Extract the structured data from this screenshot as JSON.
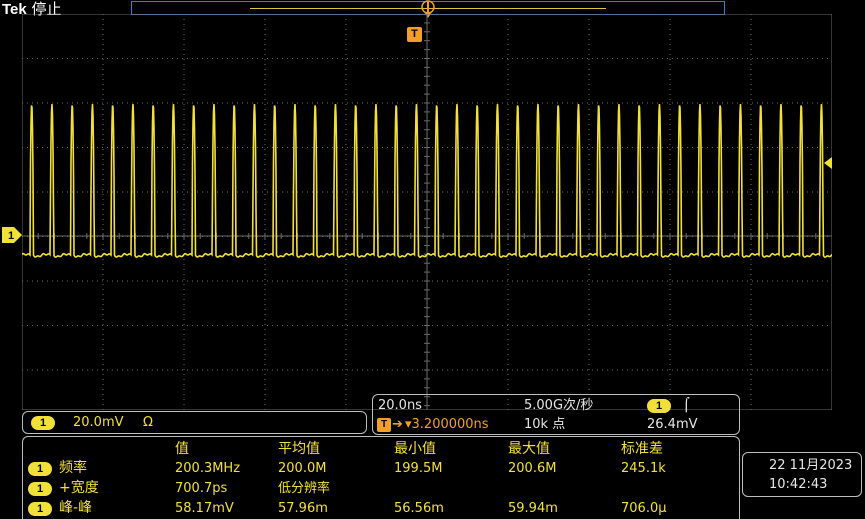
{
  "header": {
    "brand": "Tek",
    "status": "停止"
  },
  "markers": {
    "trigger_position": "T",
    "channel": "1"
  },
  "channel": {
    "badge": "1",
    "scale": "20.0mV",
    "coupling_symbol": "Ω"
  },
  "horizontal": {
    "time_scale": "20.0ns",
    "sample_rate": "5.00G次/秒",
    "trigger_source_badge": "1",
    "trigger_slope_symbol": "⌠",
    "trigger_badge": "T",
    "trigger_arrow": "➔",
    "trigger_delay": "▾3.200000ns",
    "record_length": "10k 点",
    "trigger_level": "26.4mV"
  },
  "measurements": {
    "columns": [
      "值",
      "平均值",
      "最小值",
      "最大值",
      "标准差"
    ],
    "rows": [
      {
        "badge": "1",
        "label": "频率",
        "value": "200.3MHz",
        "mean": "200.0M",
        "min": "199.5M",
        "max": "200.6M",
        "std": "245.1k"
      },
      {
        "badge": "1",
        "label": "+宽度",
        "value": "700.7ps",
        "mean": "低分辨率",
        "min": "",
        "max": "",
        "std": ""
      },
      {
        "badge": "1",
        "label": "峰-峰",
        "value": "58.17mV",
        "mean": "57.96m",
        "min": "56.56m",
        "max": "59.94m",
        "std": "706.0μ"
      }
    ]
  },
  "datetime": {
    "date": "22 11月2023",
    "time": "10:42:43"
  },
  "colors": {
    "trace": "#f2e03a",
    "grid": "#6a6a6a",
    "trigger": "#f0a028",
    "record_border": "#3f7ec8"
  },
  "waveform": {
    "type": "pulse train",
    "period_ns": 5.0,
    "pulse_height_divisions": 2.9
  }
}
